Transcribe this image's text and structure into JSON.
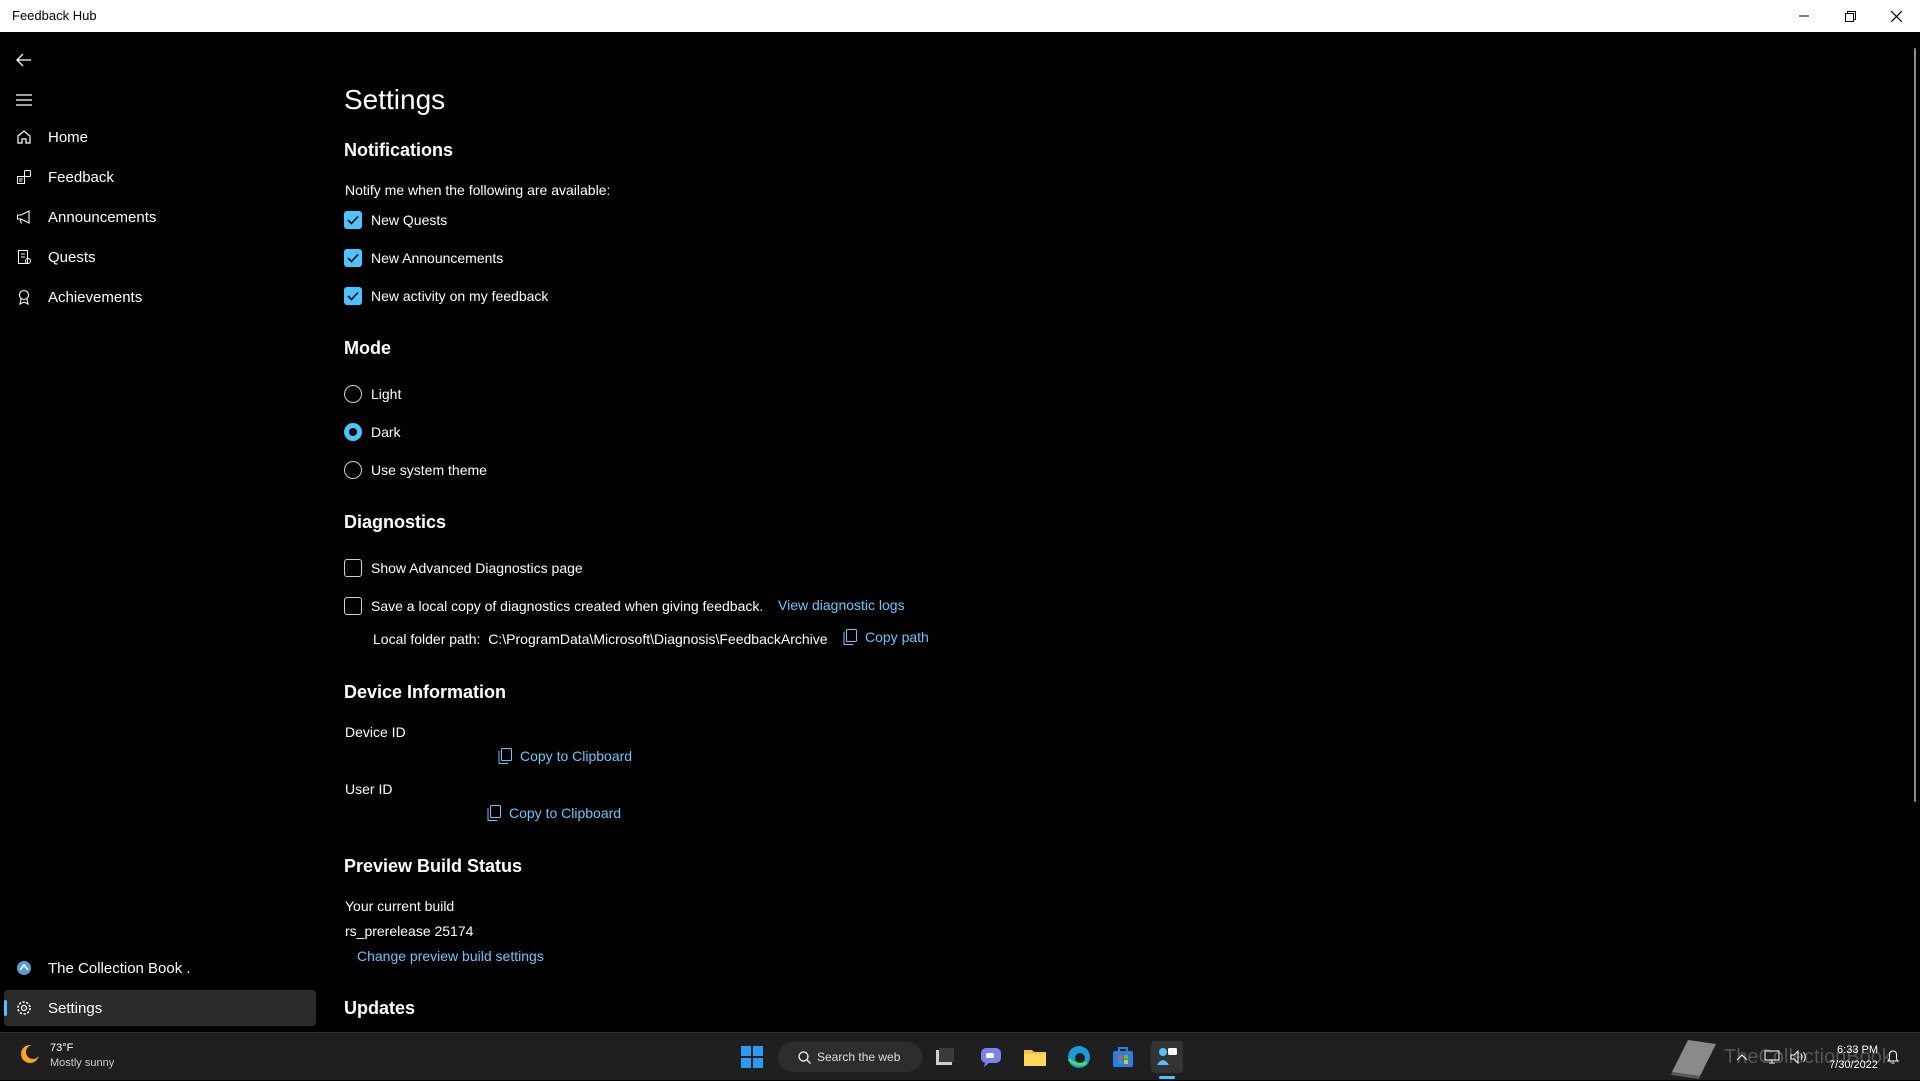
{
  "window": {
    "title": "Feedback Hub"
  },
  "sidebar": {
    "items": [
      {
        "label": "Home",
        "icon": "home-icon"
      },
      {
        "label": "Feedback",
        "icon": "feedback-icon"
      },
      {
        "label": "Announcements",
        "icon": "megaphone-icon"
      },
      {
        "label": "Quests",
        "icon": "quest-icon"
      },
      {
        "label": "Achievements",
        "icon": "achievement-icon"
      }
    ],
    "account_label": "The Collection Book .",
    "settings_label": "Settings"
  },
  "settings": {
    "title": "Settings",
    "notifications": {
      "title": "Notifications",
      "intro": "Notify me when the following are available:",
      "options": [
        {
          "label": "New Quests",
          "checked": true
        },
        {
          "label": "New Announcements",
          "checked": true
        },
        {
          "label": "New activity on my feedback",
          "checked": true
        }
      ]
    },
    "mode": {
      "title": "Mode",
      "options": [
        {
          "label": "Light",
          "selected": false
        },
        {
          "label": "Dark",
          "selected": true
        },
        {
          "label": "Use system theme",
          "selected": false
        }
      ]
    },
    "diagnostics": {
      "title": "Diagnostics",
      "show_advanced_label": "Show Advanced Diagnostics page",
      "show_advanced_checked": false,
      "save_local_label": "Save a local copy of diagnostics created when giving feedback.",
      "save_local_checked": false,
      "view_logs_link": "View diagnostic logs",
      "local_folder_label": "Local folder path:",
      "local_folder_path": "C:\\ProgramData\\Microsoft\\Diagnosis\\FeedbackArchive",
      "copy_path_label": "Copy path"
    },
    "device_info": {
      "title": "Device Information",
      "device_id_label": "Device ID",
      "user_id_label": "User ID",
      "copy_label": "Copy to Clipboard"
    },
    "preview_build": {
      "title": "Preview Build Status",
      "current_build_label": "Your current build",
      "build_value": "rs_prerelease 25174",
      "change_link": "Change preview build settings"
    },
    "updates": {
      "title": "Updates"
    }
  },
  "taskbar": {
    "weather_temp": "73°F",
    "weather_desc": "Mostly sunny",
    "search_label": "Search the web",
    "watermark": "TheCollectionBook",
    "time": "6:33 PM",
    "date": "7/30/2022"
  },
  "colors": {
    "accent": "#4cc2ff",
    "link": "#64c8ff",
    "background": "#000000"
  }
}
